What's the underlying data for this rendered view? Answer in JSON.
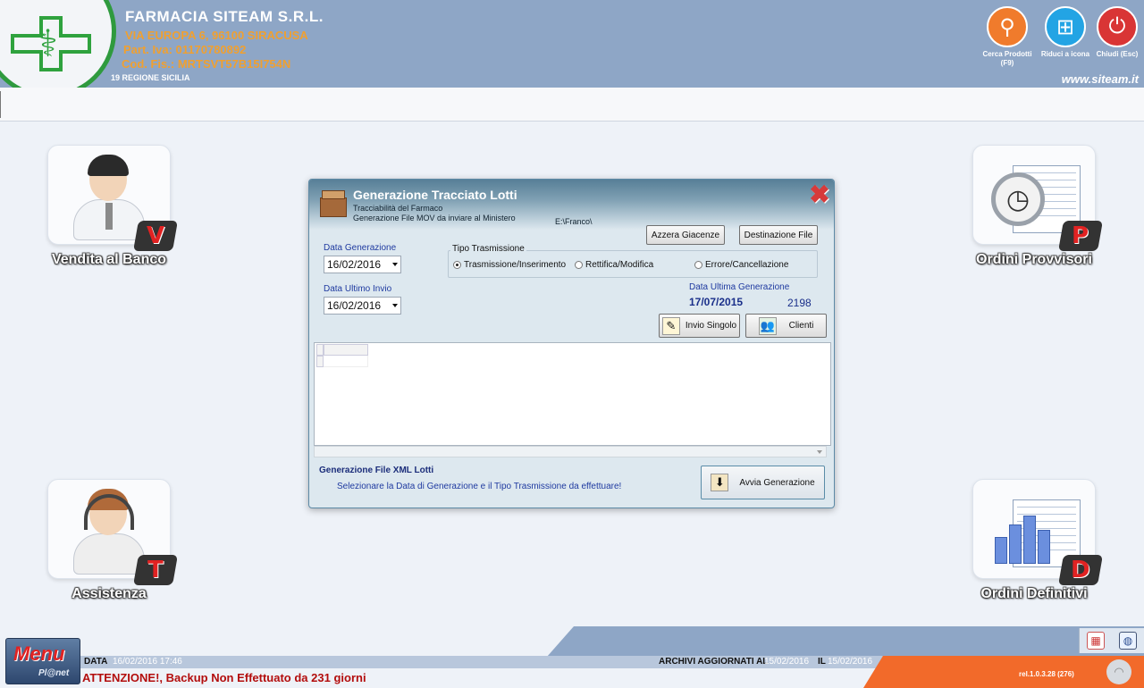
{
  "header": {
    "company_name": "FARMACIA SITEAM S.R.L.",
    "address": "VIA EUROPA 6, 96100 SIRACUSA",
    "piva": "Part. Iva: 01170780892",
    "cf": "Cod. Fis.: MRTSVT57B15I754N",
    "region": "19 REGIONE SICILIA",
    "website": "www.siteam.it",
    "buttons": {
      "search": "Cerca Prodotti (F9)",
      "minimize": "Riduci a icona",
      "close": "Chiudi (Esc)"
    }
  },
  "tiles": {
    "vendita": {
      "label": "Vendita al Banco",
      "badge": "V"
    },
    "ordini_provvisori": {
      "label": "Ordini Provvisori",
      "badge": "P"
    },
    "assistenza": {
      "label": "Assistenza",
      "badge": "T"
    },
    "ordini_definitivi": {
      "label": "Ordini Definitivi",
      "badge": "D"
    }
  },
  "dialog": {
    "title": "Generazione Tracciato Lotti",
    "subtitle1": "Tracciabilità del Farmaco",
    "subtitle2": "Generazione File MOV da inviare al Ministero",
    "path": "E:\\Franco\\",
    "btn_azzera": "Azzera Giacenze",
    "btn_destinazione": "Destinazione File",
    "lbl_data_generazione": "Data Generazione",
    "data_generazione": "16/02/2016",
    "lbl_data_ultimo_invio": "Data Ultimo Invio",
    "data_ultimo_invio": "16/02/2016",
    "tipo_trasmissione": {
      "legend": "Tipo Trasmissione",
      "options": [
        "Trasmissione/Inserimento",
        "Rettifica/Modifica",
        "Errore/Cancellazione"
      ],
      "selected": "Trasmissione/Inserimento"
    },
    "lbl_ultima_generazione": "Data Ultima Generazione",
    "ultima_generazione": "17/07/2015",
    "count": "2198",
    "btn_invio_singolo": "Invio Singolo",
    "btn_clienti": "Clienti",
    "footer_title": "Generazione File XML Lotti",
    "footer_hint": "Selezionare la Data di Generazione e il Tipo Trasmissione da effettuare!",
    "btn_avvia": "Avvia Generazione"
  },
  "statusbar": {
    "menu_title": "Menu",
    "menu_sub": "Pl@net",
    "data_label": "DATA",
    "data_value": "16/02/2016   17:46",
    "archivi_label": "ARCHIVI AGGIORNATI AL",
    "archivi_value": "15/02/2016",
    "il_label": "IL",
    "il_value": "15/02/2016",
    "version": "rel.1.0.3.28 (276)",
    "warning": "ATTENZIONE!, Backup Non Effettuato da 231 giorni"
  },
  "colors": {
    "header_bg": "#8ea6c6",
    "accent_orange": "#f26a2a",
    "accent_green": "#2fa23e",
    "warning_red": "#b30d0d",
    "label_blue": "#1f3aa0"
  },
  "icons": [
    "search-icon",
    "windows-icon",
    "power-icon",
    "calendar-icon",
    "globe-icon",
    "wifi-icon",
    "box-icon",
    "close-icon"
  ]
}
